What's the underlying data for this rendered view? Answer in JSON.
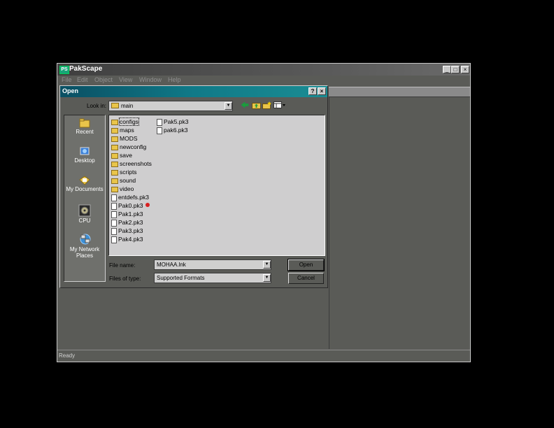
{
  "app": {
    "title": "PakScape",
    "icon": "PS",
    "menu": [
      "File",
      "Edit",
      "Object",
      "View",
      "Window",
      "Help"
    ],
    "status": "Ready",
    "controls": {
      "minimize": "_",
      "maximize": "□",
      "close": "×"
    }
  },
  "dialog": {
    "title": "Open",
    "help": "?",
    "close": "×",
    "look_in_label": "Look in:",
    "look_in_value": "main",
    "toolbar_icons": [
      "back-icon",
      "up-folder-icon",
      "new-folder-icon",
      "view-menu-icon"
    ],
    "places": [
      {
        "label": "Recent",
        "icon": "recent-icon"
      },
      {
        "label": "Desktop",
        "icon": "desktop-icon"
      },
      {
        "label": "My Documents",
        "icon": "my-documents-icon"
      },
      {
        "label": "CPU",
        "icon": "drive-icon"
      },
      {
        "label": "My Network Places",
        "icon": "network-icon"
      }
    ],
    "files_col1": [
      {
        "name": "configs",
        "type": "folder"
      },
      {
        "name": "maps",
        "type": "folder"
      },
      {
        "name": "MODS",
        "type": "folder"
      },
      {
        "name": "newconfig",
        "type": "folder"
      },
      {
        "name": "save",
        "type": "folder"
      },
      {
        "name": "screenshots",
        "type": "folder"
      },
      {
        "name": "scripts",
        "type": "folder"
      },
      {
        "name": "sound",
        "type": "folder"
      },
      {
        "name": "video",
        "type": "folder"
      },
      {
        "name": "entdefs.pk3",
        "type": "file"
      },
      {
        "name": "Pak0.pk3",
        "type": "file"
      },
      {
        "name": "Pak1.pk3",
        "type": "file"
      },
      {
        "name": "Pak2.pk3",
        "type": "file"
      },
      {
        "name": "Pak3.pk3",
        "type": "file"
      },
      {
        "name": "Pak4.pk3",
        "type": "file"
      }
    ],
    "files_col2": [
      {
        "name": "Pak5.pk3",
        "type": "file"
      },
      {
        "name": "pak6.pk3",
        "type": "file"
      }
    ],
    "file_name_label": "File name:",
    "file_name_value": "MOHAA.lnk",
    "files_of_type_label": "Files of type:",
    "files_of_type_value": "Supported Formats",
    "open_label": "Open",
    "cancel_label": "Cancel",
    "colors": {
      "title_start": "#0a4f63",
      "title_end": "#1a8c93",
      "folder": "#e9c54a",
      "marker": "#d82020"
    }
  }
}
